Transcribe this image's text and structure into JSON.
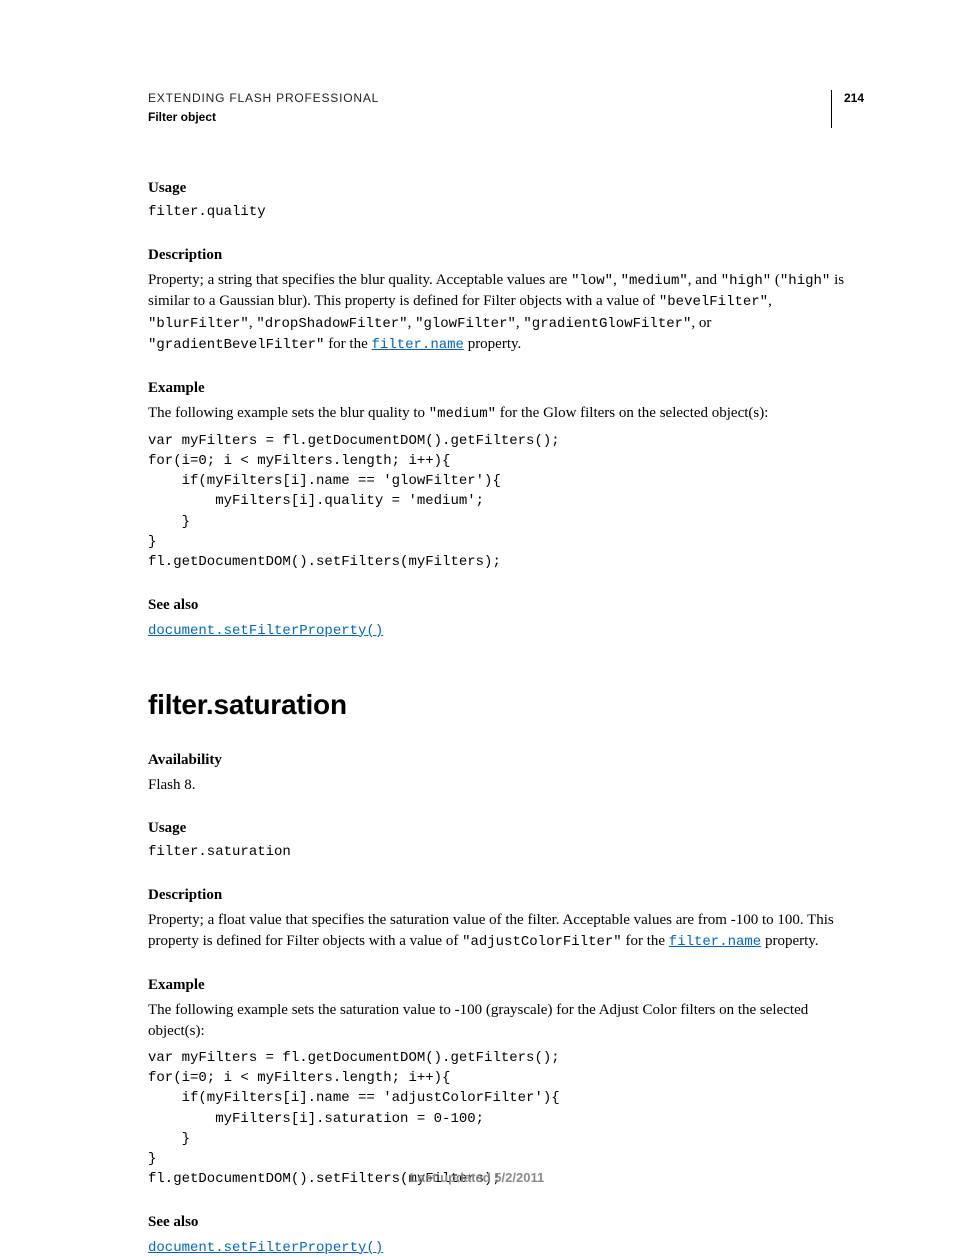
{
  "header": {
    "title": "EXTENDING FLASH PROFESSIONAL",
    "subtitle": "Filter object",
    "page_number": "214"
  },
  "quality": {
    "usage_label": "Usage",
    "usage_code": "filter.quality",
    "description_label": "Description",
    "desc_pre": "Property; a string that specifies the blur quality. Acceptable values are ",
    "v_low": "\"low\"",
    "comma1": ", ",
    "v_medium": "\"medium\"",
    "and": ", and ",
    "v_high": "\"high\"",
    "sp": " (",
    "v_high2": "\"high\"",
    "desc_mid": " is similar to a Gaussian blur). This property is defined for Filter objects with a value of ",
    "t_bevel": "\"bevelFilter\"",
    "t_blur": "\"blurFilter\"",
    "t_drop": "\"dropShadowFilter\"",
    "t_glow": "\"glowFilter\"",
    "t_gradglow": "\"gradientGlowFilter\"",
    "or": ", or ",
    "t_gradbevel": "\"gradientBevelFilter\"",
    "forthe": " for the ",
    "link_name": "filter.name",
    "desc_post": " property.",
    "example_label": "Example",
    "example_intro_pre": "The following example sets the blur quality to ",
    "example_intro_code": "\"medium\"",
    "example_intro_post": " for the Glow filters on the selected object(s):",
    "code": "var myFilters = fl.getDocumentDOM().getFilters();\nfor(i=0; i < myFilters.length; i++){\n    if(myFilters[i].name == 'glowFilter'){\n        myFilters[i].quality = 'medium';\n    }\n}\nfl.getDocumentDOM().setFilters(myFilters);",
    "seealso_label": "See also",
    "seealso_link": "document.setFilterProperty()"
  },
  "saturation": {
    "heading": "filter.saturation",
    "availability_label": "Availability",
    "availability_text": "Flash 8.",
    "usage_label": "Usage",
    "usage_code": "filter.saturation",
    "description_label": "Description",
    "desc_pre": "Property; a float value that specifies the saturation value of the filter. Acceptable values are from -100 to 100. This property is defined for Filter objects with a value of ",
    "t_adjust": "\"adjustColorFilter\"",
    "forthe": " for the ",
    "link_name": "filter.name",
    "desc_post": " property.",
    "example_label": "Example",
    "example_intro": "The following example sets the saturation value to -100 (grayscale) for the Adjust Color filters on the selected object(s):",
    "code": "var myFilters = fl.getDocumentDOM().getFilters();\nfor(i=0; i < myFilters.length; i++){\n    if(myFilters[i].name == 'adjustColorFilter'){\n        myFilters[i].saturation = 0-100;\n    }\n}\nfl.getDocumentDOM().setFilters(myFilters);",
    "seealso_label": "See also",
    "seealso_link": "document.setFilterProperty()"
  },
  "footer": "Last updated 5/2/2011"
}
